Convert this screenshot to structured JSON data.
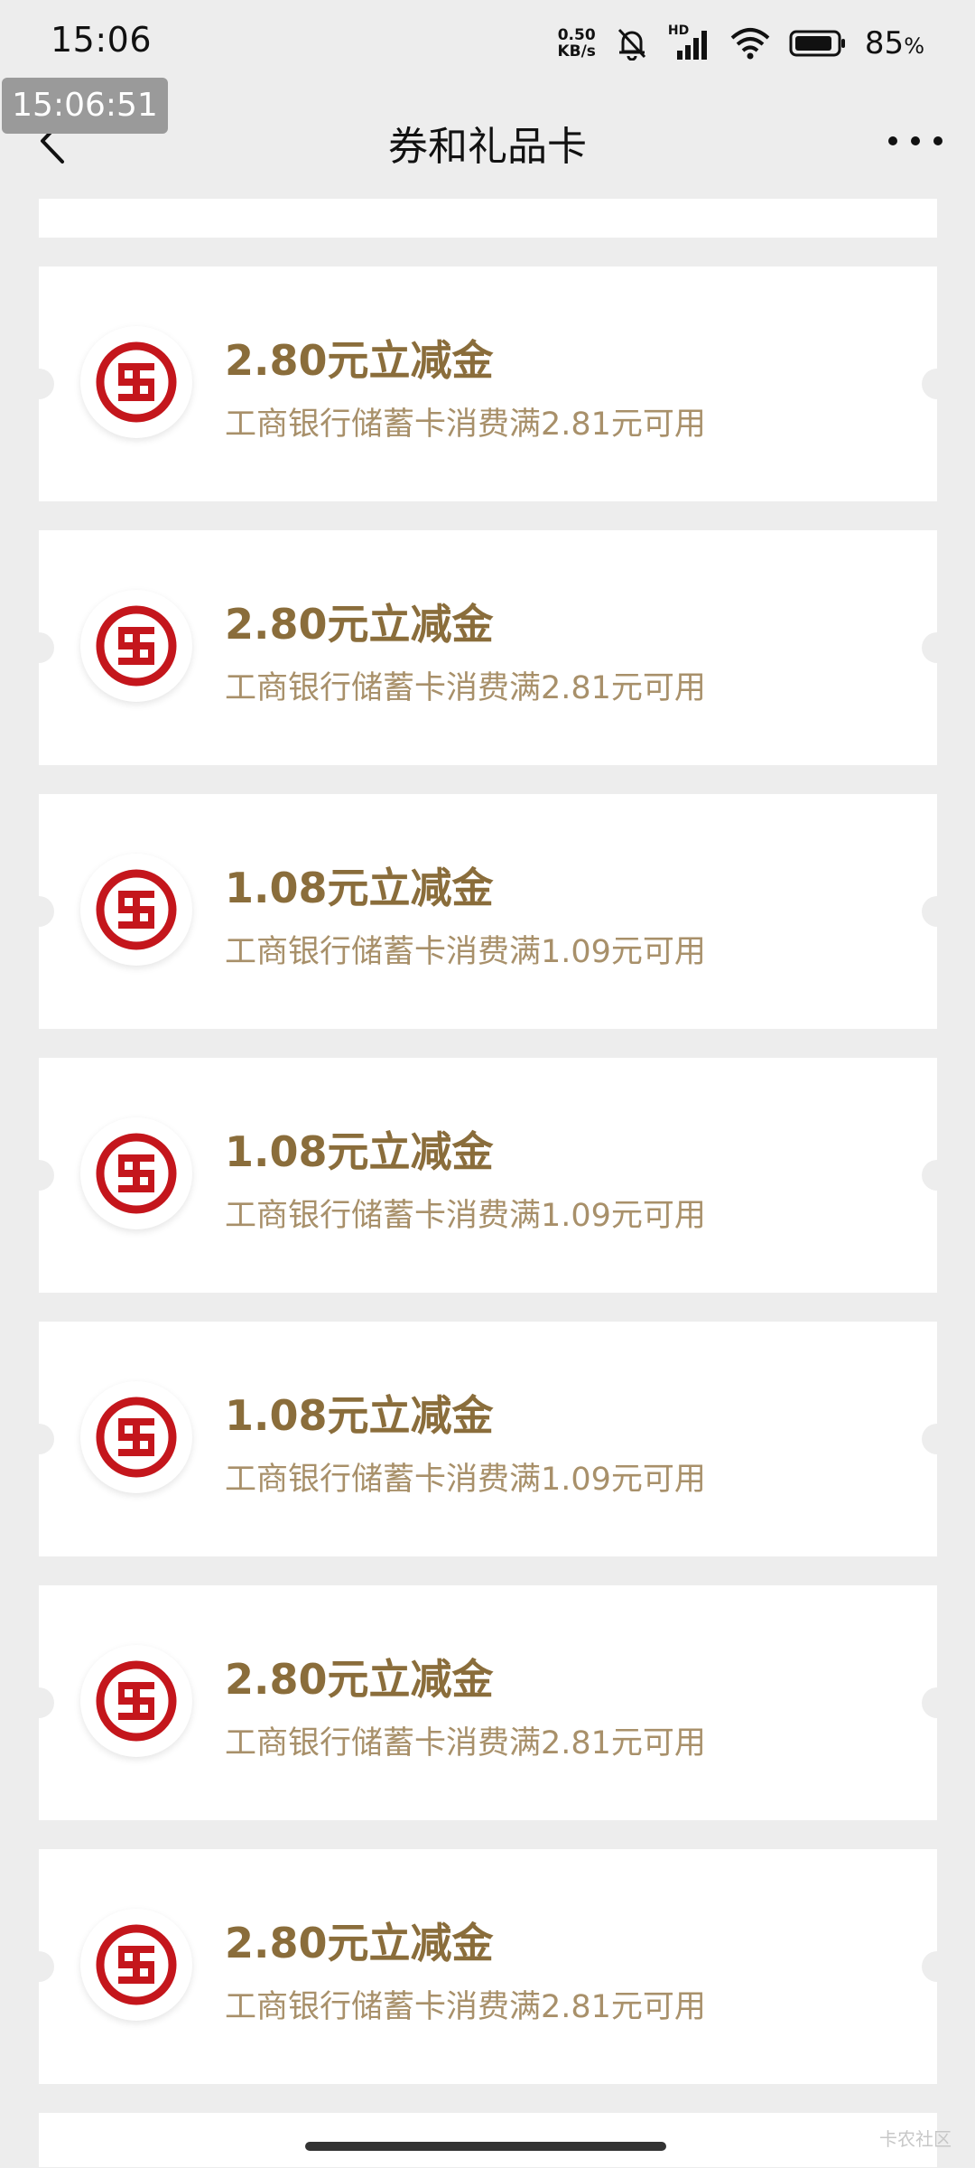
{
  "status_bar": {
    "time": "15:06",
    "net_speed_value": "0.50",
    "net_speed_unit": "KB/s",
    "signal_label": "HD",
    "battery_percent": "85",
    "battery_percent_sign": "%"
  },
  "screenshot_timestamp": "15:06:51",
  "nav": {
    "title": "券和礼品卡"
  },
  "coupons": [
    {
      "title": "2.80元立减金",
      "desc": "工商银行储蓄卡消费满2.81元可用"
    },
    {
      "title": "2.80元立减金",
      "desc": "工商银行储蓄卡消费满2.81元可用"
    },
    {
      "title": "1.08元立减金",
      "desc": "工商银行储蓄卡消费满1.09元可用"
    },
    {
      "title": "1.08元立减金",
      "desc": "工商银行储蓄卡消费满1.09元可用"
    },
    {
      "title": "1.08元立减金",
      "desc": "工商银行储蓄卡消费满1.09元可用"
    },
    {
      "title": "2.80元立减金",
      "desc": "工商银行储蓄卡消费满2.81元可用"
    },
    {
      "title": "2.80元立减金",
      "desc": "工商银行储蓄卡消费满2.81元可用"
    }
  ],
  "icons": {
    "back": "chevron-left-icon",
    "more": "more-dots-icon",
    "bank_logo": "icbc-logo-icon"
  },
  "colors": {
    "background": "#ededed",
    "card": "#ffffff",
    "title_gold": "#8a6d3b",
    "desc_gold": "#a8906a",
    "icbc_red": "#c4161c"
  },
  "watermark": "卡农社区"
}
